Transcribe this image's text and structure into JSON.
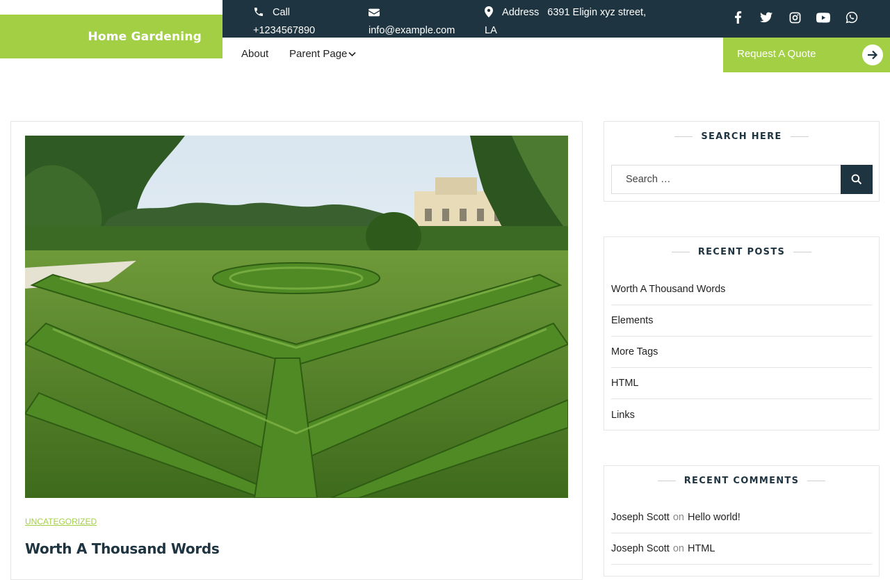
{
  "brand": {
    "name": "Home Gardening",
    "accent": "#a3cf45",
    "dark": "#1e3440"
  },
  "topbar": {
    "call_label": "Call",
    "phone": "+1234567890",
    "email": "info@example.com",
    "address_label": "Address",
    "address_value": "6391 Eligin xyz street,",
    "address_value_2": "LA",
    "social": [
      "facebook-icon",
      "twitter-icon",
      "instagram-icon",
      "youtube-icon",
      "whatsapp-icon"
    ]
  },
  "nav": {
    "items": [
      {
        "label": "About"
      },
      {
        "label": "Parent Page",
        "has_dropdown": true
      }
    ],
    "cta": "Request A Quote"
  },
  "post": {
    "category": "UNCATEGORIZED",
    "title": "Worth A Thousand Words",
    "image": "garden-hedge-maze-photo"
  },
  "sidebar": {
    "search": {
      "title": "SEARCH HERE",
      "placeholder": "Search …"
    },
    "recent_posts": {
      "title": "RECENT POSTS",
      "items": [
        "Worth A Thousand Words",
        "Elements",
        "More Tags",
        "HTML",
        "Links"
      ]
    },
    "recent_comments": {
      "title": "RECENT COMMENTS",
      "items": [
        {
          "author": "Joseph Scott",
          "on": "on",
          "post": "Hello world!"
        },
        {
          "author": "Joseph Scott",
          "on": "on",
          "post": "HTML"
        }
      ]
    }
  }
}
